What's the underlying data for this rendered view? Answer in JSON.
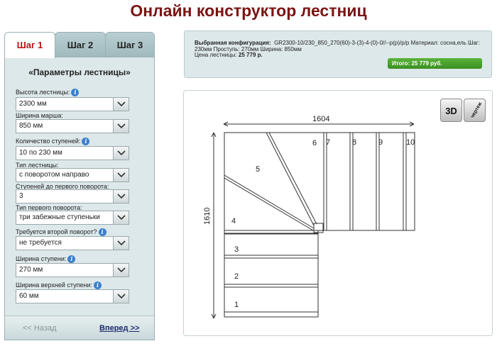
{
  "page": {
    "title": "Онлайн конструктор лестниц"
  },
  "tabs": [
    {
      "label": "Шаг 1"
    },
    {
      "label": "Шаг 2"
    },
    {
      "label": "Шаг 3"
    }
  ],
  "panel": {
    "heading": "«Параметры лестницы»",
    "fields": [
      {
        "label": "Высота лестницы:",
        "value": "2300 мм",
        "info": true
      },
      {
        "label": "Ширина марша:",
        "value": "850 мм",
        "info": false
      },
      {
        "label": "Количество ступеней:",
        "value": "10 по 230 мм",
        "info": true
      },
      {
        "label": "Тип лестницы:",
        "value": "с поворотом направо",
        "info": false
      },
      {
        "label": "Ступеней до первого поворота:",
        "value": "3",
        "info": false
      },
      {
        "label": "Тип первого поворота:",
        "value": "три забежные ступеньки",
        "info": false
      },
      {
        "label": "Требуется второй поворот?",
        "value": "не требуется",
        "info": true
      },
      {
        "label": "Ширина ступени:",
        "value": "270 мм",
        "info": true
      },
      {
        "label": "Ширина верхней ступени:",
        "value": "60 мм",
        "info": true
      }
    ],
    "back_label": "<< Назад",
    "next_label": "Вперед >>"
  },
  "summary": {
    "config_label": "Выбранная конфигурация:",
    "config_value": "GR2300-10/230_850_270(60)-3-(3)-4-(0)-0//--p(p)/p/p Материал: сосна,ель Шаг: 230мм Проступь: 270мм Ширина: 850мм",
    "price_text": "Цена лестницы:",
    "price_value": "25 779 р.",
    "total_text": "Итого: 25 779 руб."
  },
  "drawing": {
    "width_label": "1604",
    "height_label": "1610",
    "step_numbers": [
      "1",
      "2",
      "3",
      "4",
      "5",
      "6",
      "7",
      "8",
      "9",
      "10"
    ]
  },
  "view_buttons": {
    "three_d": "3D",
    "drawing": "чертеж"
  },
  "colors": {
    "title": "#7b1414",
    "active_tab": "#b31414",
    "total_badge": "#3b8f22",
    "panel_bg": "#dde8ea"
  }
}
